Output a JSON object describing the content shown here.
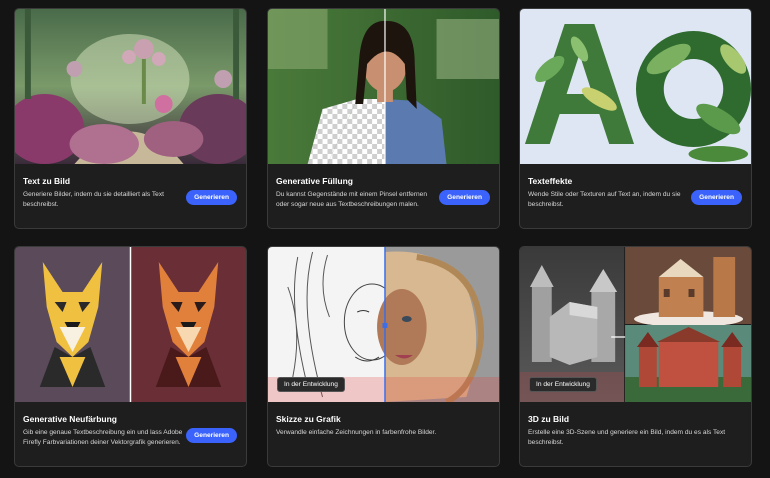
{
  "cards": [
    {
      "title": "Text zu Bild",
      "description": "Generiere Bilder, indem du sie detailliert als Text beschreibst.",
      "button": "Generieren"
    },
    {
      "title": "Generative Füllung",
      "description": "Du kannst Gegenstände mit einem Pinsel entfernen oder sogar neue aus Textbeschreibungen malen.",
      "button": "Generieren"
    },
    {
      "title": "Texteffekte",
      "description": "Wende Stile oder Texturen auf Text an, indem du sie beschreibst.",
      "button": "Generieren"
    },
    {
      "title": "Generative Neufärbung",
      "description": "Gib eine genaue Textbeschreibung ein und lass Adobe Firefly Farbvariationen deiner Vektorgrafik generieren.",
      "button": "Generieren"
    },
    {
      "title": "Skizze zu Grafik",
      "description": "Verwandle einfache Zeichnungen in farbenfrohe Bilder.",
      "badge": "In der Entwicklung"
    },
    {
      "title": "3D zu Bild",
      "description": "Erstelle eine 3D-Szene und generiere ein Bild, indem du es als Text beschreibst.",
      "badge": "In der Entwicklung"
    }
  ],
  "colors": {
    "accent": "#3b63fb",
    "card_bg": "#1e1e1e",
    "page_bg": "#141414"
  }
}
